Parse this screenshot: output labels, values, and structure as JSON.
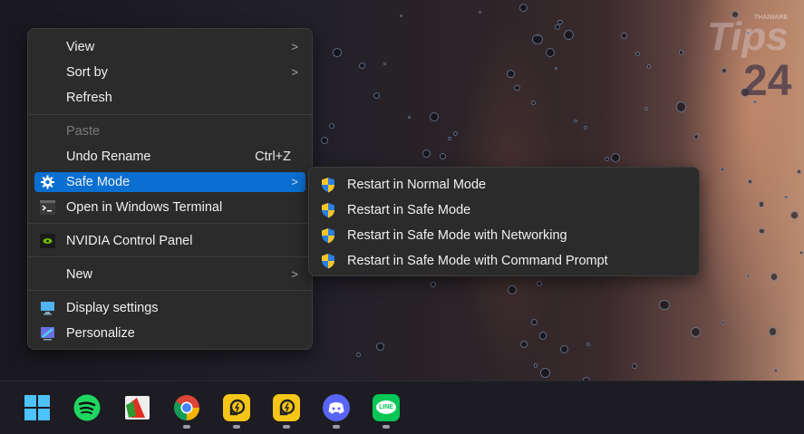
{
  "watermark": {
    "text": "Tips",
    "number": "24",
    "brand": "THAIWARE"
  },
  "context_menu": {
    "items": [
      {
        "label": "View",
        "submenu": true
      },
      {
        "label": "Sort by",
        "submenu": true
      },
      {
        "label": "Refresh"
      },
      {
        "label": "Paste",
        "disabled": true
      },
      {
        "label": "Undo Rename",
        "shortcut": "Ctrl+Z"
      },
      {
        "label": "Safe Mode",
        "submenu": true,
        "icon": "gear-icon",
        "highlighted": true
      },
      {
        "label": "Open in Windows Terminal",
        "icon": "terminal-icon"
      },
      {
        "label": "NVIDIA Control Panel",
        "icon": "nvidia-icon"
      },
      {
        "label": "New",
        "submenu": true
      },
      {
        "label": "Display settings",
        "icon": "display-icon"
      },
      {
        "label": "Personalize",
        "icon": "personalize-icon"
      }
    ],
    "highlight_color": "#0a6fd0"
  },
  "submenu": {
    "items": [
      {
        "label": "Restart in Normal Mode",
        "icon": "uac-shield-icon"
      },
      {
        "label": "Restart in Safe Mode",
        "icon": "uac-shield-icon"
      },
      {
        "label": "Restart in Safe Mode with Networking",
        "icon": "uac-shield-icon"
      },
      {
        "label": "Restart in Safe Mode with Command Prompt",
        "icon": "uac-shield-icon"
      }
    ]
  },
  "taskbar": {
    "apps": [
      {
        "name": "Start",
        "icon": "windows-start-icon",
        "running": false
      },
      {
        "name": "Spotify",
        "icon": "spotify-icon",
        "running": false
      },
      {
        "name": "FastStone Capture",
        "icon": "faststone-icon",
        "running": false
      },
      {
        "name": "Chrome",
        "icon": "chrome-icon",
        "running": true
      },
      {
        "name": "LDPlayer",
        "icon": "ldplayer-icon",
        "running": true
      },
      {
        "name": "LDPlayer",
        "icon": "ldplayer-icon",
        "running": true
      },
      {
        "name": "Discord",
        "icon": "discord-icon",
        "running": true
      },
      {
        "name": "LINE",
        "icon": "line-icon",
        "running": true,
        "label": "LINE"
      }
    ]
  }
}
